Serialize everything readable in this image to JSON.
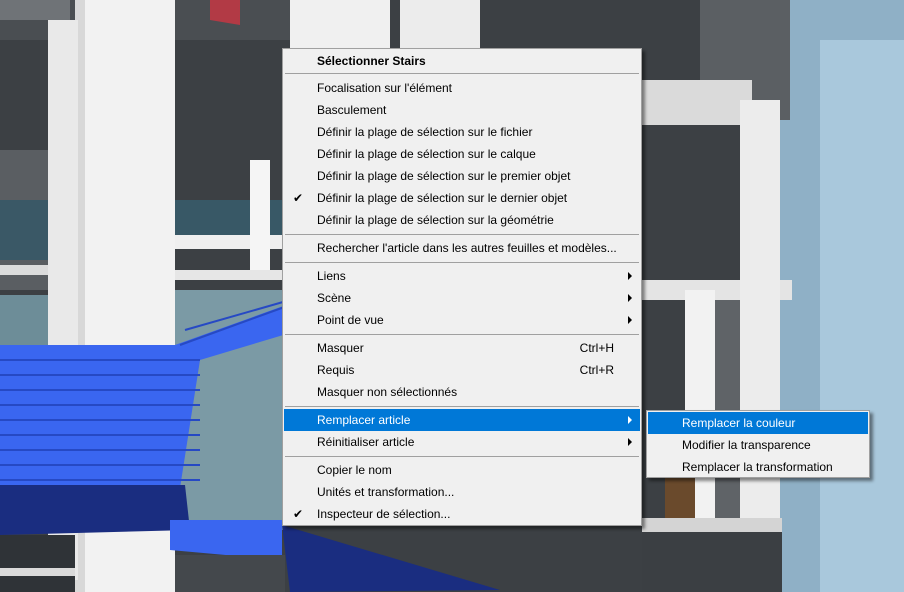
{
  "menu": {
    "title": "Sélectionner Stairs",
    "group1": [
      {
        "label": "Focalisation sur l'élément",
        "checked": false
      },
      {
        "label": "Basculement",
        "checked": false
      },
      {
        "label": "Définir la plage de sélection sur le fichier",
        "checked": false
      },
      {
        "label": "Définir la plage de sélection sur le calque",
        "checked": false
      },
      {
        "label": "Définir la plage de sélection sur le premier objet",
        "checked": false
      },
      {
        "label": "Définir la plage de sélection sur le dernier objet",
        "checked": true,
        "check_glyph": "✔"
      },
      {
        "label": "Définir la plage de sélection sur la géométrie",
        "checked": false
      }
    ],
    "search_label": "Rechercher l'article dans les autres feuilles et modèles...",
    "group3": [
      {
        "label": "Liens"
      },
      {
        "label": "Scène"
      },
      {
        "label": "Point de vue"
      }
    ],
    "group4": [
      {
        "label": "Masquer",
        "shortcut": "Ctrl+H"
      },
      {
        "label": "Requis",
        "shortcut": "Ctrl+R"
      },
      {
        "label": "Masquer non sélectionnés",
        "shortcut": ""
      }
    ],
    "group5": [
      {
        "label": "Remplacer article",
        "highlighted": true
      },
      {
        "label": "Réinitialiser article",
        "highlighted": false
      }
    ],
    "group6": [
      {
        "label": "Copier le nom",
        "checked": false
      },
      {
        "label": "Unités et transformation...",
        "checked": false
      },
      {
        "label": "Inspecteur de sélection...",
        "checked": true,
        "check_glyph": "✔"
      }
    ]
  },
  "submenu": {
    "items": [
      {
        "label": "Remplacer la couleur",
        "highlighted": true
      },
      {
        "label": "Modifier la transparence",
        "highlighted": false
      },
      {
        "label": "Remplacer la transformation",
        "highlighted": false
      }
    ]
  },
  "colors": {
    "highlight": "#0078d7",
    "menu_bg": "#f0f0f0",
    "stairs_blue": "#3a66f0",
    "stairs_dark": "#1a2d80"
  }
}
